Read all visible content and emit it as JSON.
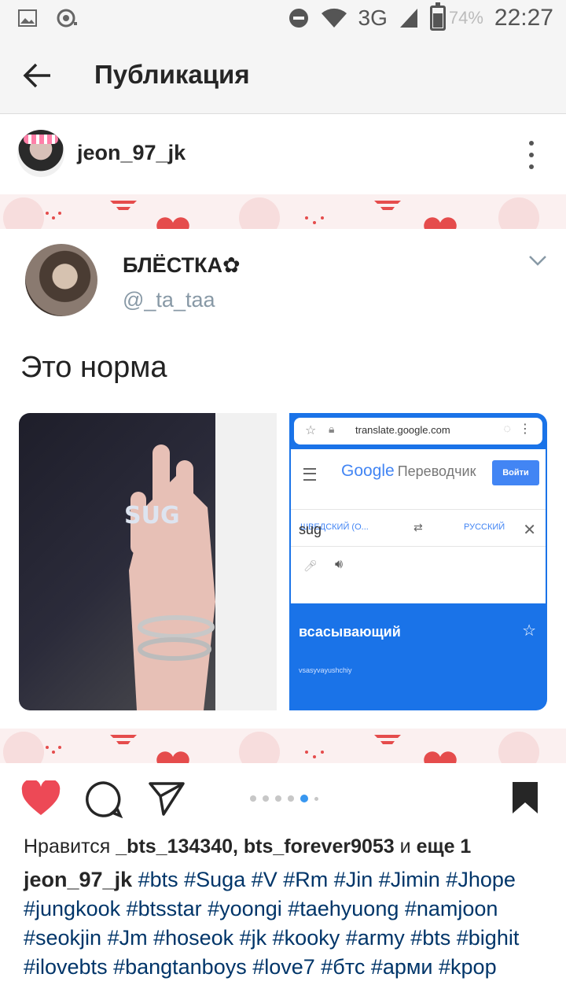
{
  "status_bar": {
    "network": "3G",
    "battery_percent": "74%",
    "time": "22:27"
  },
  "app_bar": {
    "title": "Публикация"
  },
  "post": {
    "username": "jeon_97_jk"
  },
  "tweet": {
    "name": "БЛЁСТКА✿",
    "handle": "@_ta_taa",
    "text": "Это норма",
    "ring_text": "SUG",
    "translate": {
      "url": "translate.google.com",
      "logo": "Google",
      "logo_sub": "Переводчик",
      "signin": "Войти",
      "source_lang": "ШВЕДСКИЙ (О...",
      "target_lang": "РУССКИЙ",
      "input": "sug",
      "result": "всасывающий",
      "translit": "vsasyvayushchiy"
    }
  },
  "carousel": {
    "count": 6,
    "active_index": 4
  },
  "likes": {
    "prefix": "Нравится",
    "users": "_bts_134340, bts_forever9053",
    "joiner": "и",
    "more": "еще 1"
  },
  "caption": {
    "username": "jeon_97_jk",
    "hashtags": "#bts #Suga #V #Rm #Jin #Jimin #Jhope #jungkook #btsstar #yoongi #taehyuong #namjoon #seokjin #Jm #hoseok #jk #kooky #army #bts #bighit #ilovebts #bangtanboys #love7 #бтс #арми #kpop"
  },
  "icons": {
    "like": "heart-filled-icon",
    "comment": "comment-bubble-icon",
    "share": "send-icon",
    "save": "bookmark-filled-icon",
    "colors": {
      "like": "#ed4956",
      "hashtag": "#003569",
      "carousel_active": "#3897f0"
    }
  }
}
